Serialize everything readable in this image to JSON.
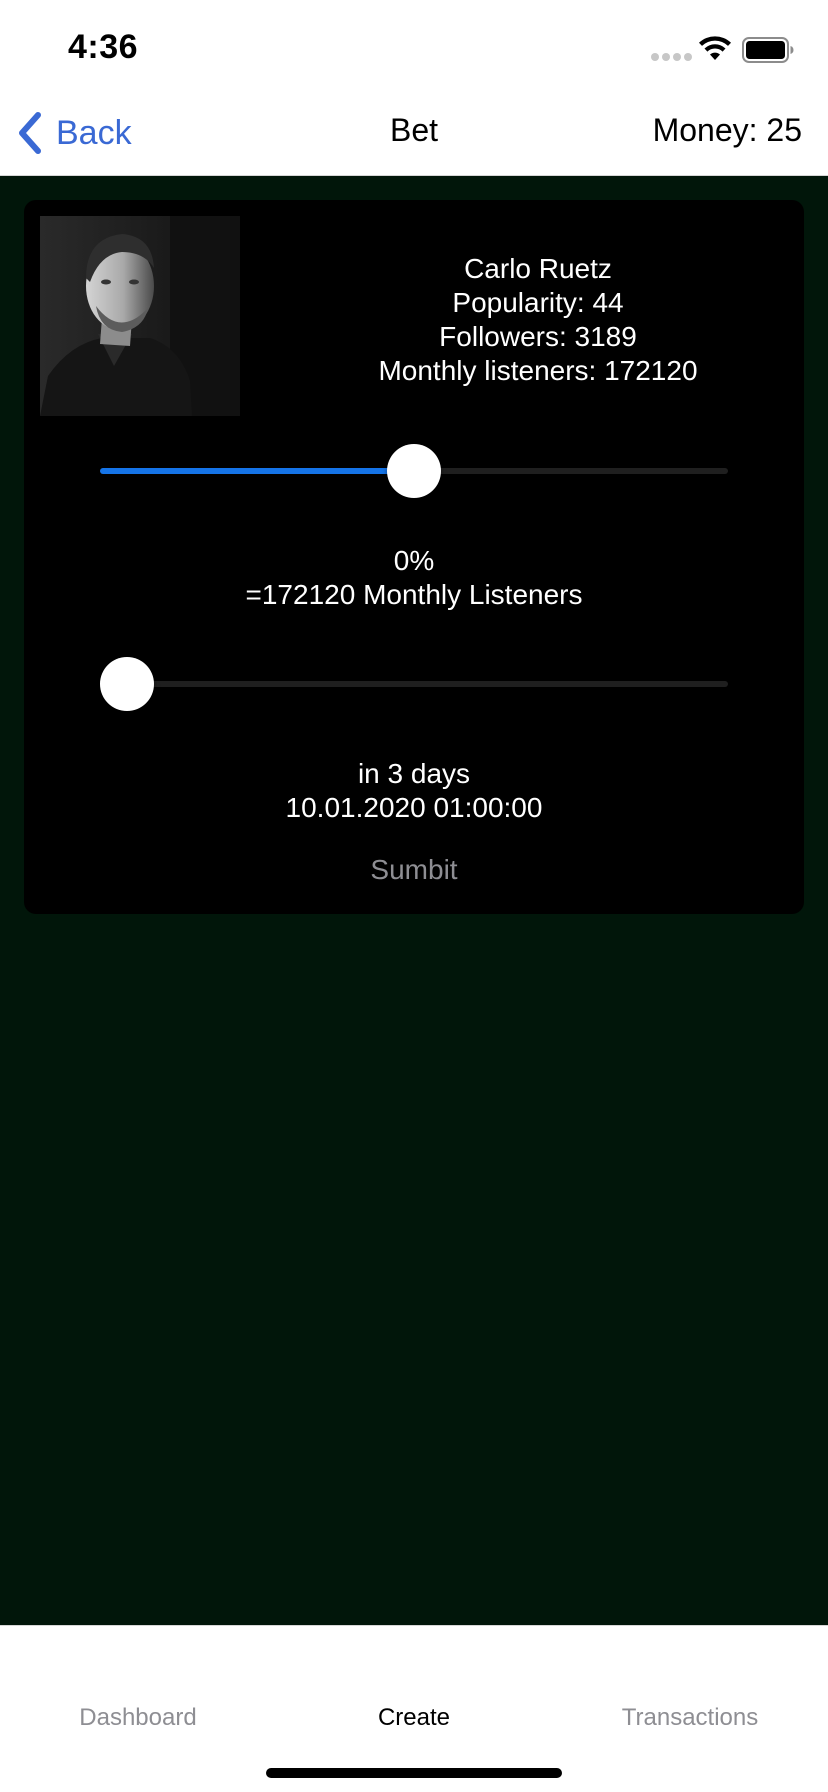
{
  "status_bar": {
    "time": "4:36"
  },
  "nav": {
    "back_label": "Back",
    "title": "Bet",
    "money": "Money: 25"
  },
  "artist": {
    "name": "Carlo Ruetz",
    "popularity": "Popularity: 44",
    "followers": "Followers: 3189",
    "monthly_listeners": "Monthly listeners: 172120"
  },
  "percent_slider": {
    "value_fraction": 0.5
  },
  "percent_text": "0%",
  "listeners_text": "=172120 Monthly Listeners",
  "days_slider": {
    "value_fraction": 0.0
  },
  "days_text": "in 3 days",
  "date_text": "10.01.2020 01:00:00",
  "submit_label": "Sumbit",
  "tabs": [
    {
      "label": "Dashboard",
      "active": false
    },
    {
      "label": "Create",
      "active": true
    },
    {
      "label": "Transactions",
      "active": false
    }
  ],
  "colors": {
    "accent": "#3a69d4",
    "slider_fill": "#1574e8",
    "background": "#01160a",
    "card": "#000000"
  }
}
